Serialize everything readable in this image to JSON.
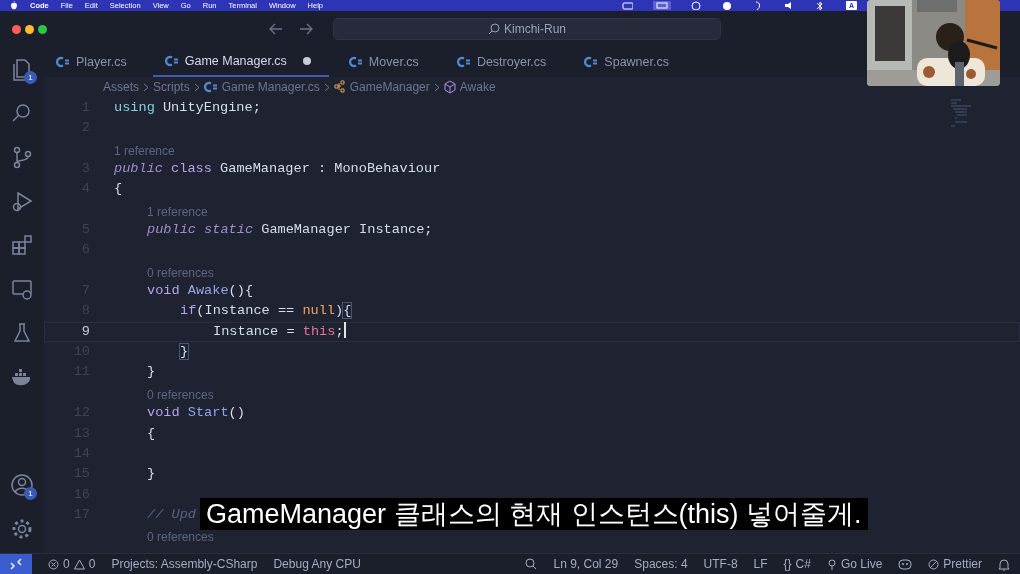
{
  "menu_bar": {
    "app": "Code",
    "items": [
      "File",
      "Edit",
      "Selection",
      "View",
      "Go",
      "Run",
      "Terminal",
      "Window",
      "Help"
    ],
    "input_source": "A"
  },
  "title_bar": {
    "search": "Kimchi-Run"
  },
  "activity_bar": {
    "top": [
      {
        "kind": "explorer",
        "badge": "1"
      },
      {
        "kind": "search"
      },
      {
        "kind": "source-control"
      },
      {
        "kind": "run-debug"
      },
      {
        "kind": "extensions"
      },
      {
        "kind": "remote"
      },
      {
        "kind": "testing"
      },
      {
        "kind": "docker"
      }
    ],
    "bottom": [
      {
        "kind": "account",
        "badge": "1"
      },
      {
        "kind": "settings"
      }
    ]
  },
  "tabs": [
    {
      "label": "Player.cs",
      "selected": false,
      "modified": false
    },
    {
      "label": "Game Manager.cs",
      "selected": true,
      "modified": true
    },
    {
      "label": "Mover.cs",
      "selected": false,
      "modified": false
    },
    {
      "label": "Destroyer.cs",
      "selected": false,
      "modified": false
    },
    {
      "label": "Spawner.cs",
      "selected": false,
      "modified": false
    }
  ],
  "breadcrumbs": [
    {
      "kind": "folder",
      "label": "Assets"
    },
    {
      "kind": "folder",
      "label": "Scripts"
    },
    {
      "kind": "file",
      "label": "Game Manager.cs"
    },
    {
      "kind": "class",
      "label": "GameManager"
    },
    {
      "kind": "method",
      "label": "Awake"
    }
  ],
  "code": [
    {
      "number": "1",
      "tokens": [
        {
          "kind": "kw2",
          "text": "using"
        },
        {
          "kind": "plain",
          "text": " UnityEngine;"
        }
      ]
    },
    {
      "number": "2"
    },
    {
      "kind": "lens",
      "text": "1 reference"
    },
    {
      "number": "3",
      "tokens": [
        {
          "kind": "mod",
          "text": "public"
        },
        {
          "kind": "kw",
          "text": " class"
        },
        {
          "kind": "plain",
          "text": " GameManager : MonoBehaviour"
        }
      ]
    },
    {
      "number": "4",
      "tokens": [
        {
          "kind": "plain",
          "text": "{"
        }
      ]
    },
    {
      "kind": "lens",
      "text": "    1 reference"
    },
    {
      "number": "5",
      "tokens": [
        {
          "kind": "mod",
          "text": "    public static"
        },
        {
          "kind": "plain",
          "text": " GameManager Instance;"
        }
      ]
    },
    {
      "number": "6"
    },
    {
      "kind": "lens",
      "text": "    0 references"
    },
    {
      "number": "7",
      "tokens": [
        {
          "kind": "kw",
          "text": "    void"
        },
        {
          "kind": "fn",
          "text": " Awake"
        },
        {
          "kind": "plain",
          "text": "(){"
        }
      ]
    },
    {
      "number": "8",
      "tokens": [
        {
          "kind": "kw",
          "text": "        if"
        },
        {
          "kind": "plain",
          "text": "(Instance == "
        },
        {
          "kind": "lit",
          "text": "null"
        },
        {
          "kind": "plain",
          "text": ")"
        },
        {
          "kind": "match",
          "text": "{"
        }
      ]
    },
    {
      "number": "9",
      "current": true,
      "tokens": [
        {
          "kind": "plain",
          "text": "            Instance = "
        },
        {
          "kind": "this",
          "text": "this"
        },
        {
          "kind": "plain",
          "text": ";"
        }
      ]
    },
    {
      "number": "10",
      "tokens": [
        {
          "kind": "match",
          "text": "        }"
        }
      ]
    },
    {
      "number": "11",
      "tokens": [
        {
          "kind": "plain",
          "text": "    }"
        }
      ]
    },
    {
      "kind": "lens",
      "text": "    0 references"
    },
    {
      "number": "12",
      "tokens": [
        {
          "kind": "kw",
          "text": "    void"
        },
        {
          "kind": "fn",
          "text": " Start"
        },
        {
          "kind": "plain",
          "text": "()"
        }
      ]
    },
    {
      "number": "13",
      "tokens": [
        {
          "kind": "plain",
          "text": "    {"
        }
      ]
    },
    {
      "number": "14"
    },
    {
      "number": "15",
      "tokens": [
        {
          "kind": "plain",
          "text": "    }"
        }
      ]
    },
    {
      "number": "16"
    },
    {
      "number": "17",
      "tokens": [
        {
          "kind": "comment",
          "text": "    // Upd"
        }
      ]
    },
    {
      "kind": "lens",
      "text": "    0 references"
    }
  ],
  "subtitle": "GameManager 클래스의 현재 인스턴스(this) 넣어줄게.",
  "status_bar": {
    "errors": "0",
    "warnings": "0",
    "left": [
      "Projects: Assembly-CSharp",
      "Debug Any CPU"
    ],
    "position": "Ln 9, Col 29",
    "spaces": "Spaces: 4",
    "encoding": "UTF-8",
    "eol": "LF",
    "language_braces": "{}",
    "language": "C#",
    "go_live": "Go Live",
    "prettier": "Prettier"
  }
}
